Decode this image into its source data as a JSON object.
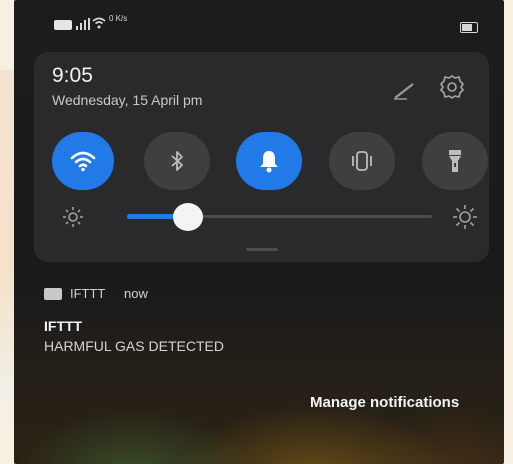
{
  "status_bar": {
    "icons": [
      "sim-card-icon",
      "signal-icon",
      "wifi-icon",
      "data-speed-icon",
      "battery-icon"
    ],
    "data_speed": "0 K/s"
  },
  "quick_settings": {
    "time": "9:05",
    "date": "Wednesday, 15 April  pm",
    "edit_icon": "pencil-icon",
    "settings_icon": "gear-icon",
    "toggles": [
      {
        "name": "wifi",
        "icon": "wifi-icon",
        "on": true
      },
      {
        "name": "bluetooth",
        "icon": "bluetooth-icon",
        "on": false
      },
      {
        "name": "sound",
        "icon": "bell-icon",
        "on": true
      },
      {
        "name": "vibrate",
        "icon": "vibrate-icon",
        "on": false
      },
      {
        "name": "flashlight",
        "icon": "flashlight-icon",
        "on": false
      }
    ],
    "brightness": 0.2,
    "accent_color": "#2279e8"
  },
  "notification": {
    "app": "IFTTT",
    "time": "now",
    "title": "IFTTT",
    "body": "HARMFUL GAS DETECTED"
  },
  "footer": {
    "manage_label": "Manage notifications"
  }
}
